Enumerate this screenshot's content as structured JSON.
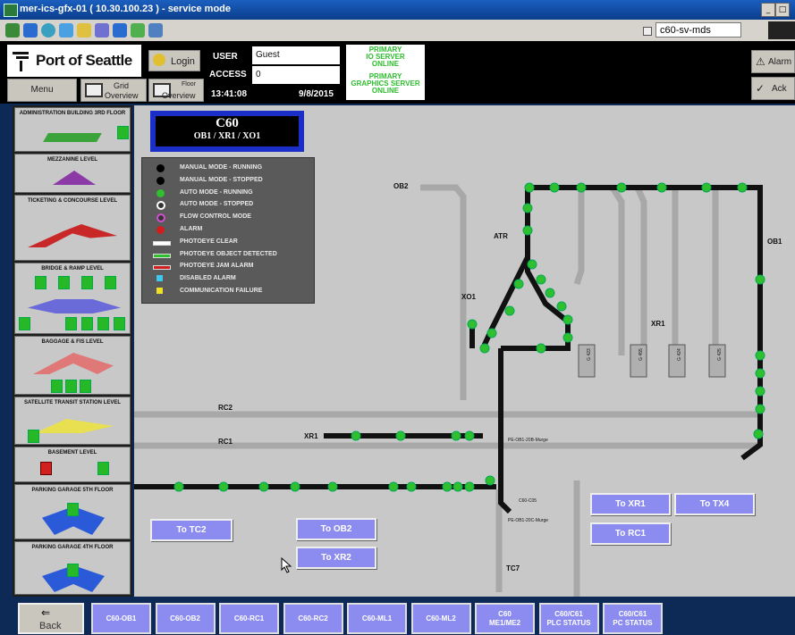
{
  "window": {
    "title": "mer-ics-gfx-01 ( 10.30.100.23 ) - service mode",
    "host": "c60-sv-mds"
  },
  "header": {
    "logo": "Port of Seattle",
    "login": "Login",
    "user_label": "USER",
    "user_value": "Guest",
    "access_label": "ACCESS",
    "access_value": "0",
    "time": "13:41:08",
    "date": "9/8/2015",
    "server1": [
      "PRIMARY",
      "IO SERVER",
      "ONLINE"
    ],
    "server2": [
      "PRIMARY",
      "GRAPHICS SERVER",
      "ONLINE"
    ],
    "menu": "Menu",
    "grid_overview": [
      "Grid",
      "Overview"
    ],
    "floor_overview": [
      "Floor",
      "Overview"
    ],
    "alarm": "Alarm",
    "ack": "Ack"
  },
  "sidebar": [
    "ADMINISTRATION BUILDING 3RD FLOOR",
    "MEZZANINE LEVEL",
    "TICKETING & CONCOURSE LEVEL",
    "BRIDGE & RAMP LEVEL",
    "BAGGAGE & FIS LEVEL",
    "SATELLITE TRANSIT STATION LEVEL",
    "BASEMENT LEVEL",
    "PARKING GARAGE 5TH FLOOR",
    "PARKING GARAGE 4TH FLOOR"
  ],
  "station": {
    "title": "C60",
    "subtitle": "OB1 / XR1 / XO1"
  },
  "legend": [
    {
      "text": "MANUAL MODE - RUNNING",
      "color": "#000000",
      "kind": "dot"
    },
    {
      "text": "MANUAL MODE - STOPPED",
      "color": "#000000",
      "kind": "dot"
    },
    {
      "text": "AUTO MODE - RUNNING",
      "color": "#2fbf2f",
      "kind": "dot"
    },
    {
      "text": "AUTO MODE - STOPPED",
      "color": "#ffffff",
      "kind": "ring"
    },
    {
      "text": "FLOW CONTROL MODE",
      "color": "#d24fd2",
      "kind": "ring"
    },
    {
      "text": "ALARM",
      "color": "#d01e1e",
      "kind": "dot"
    },
    {
      "text": "PHOTOEYE CLEAR",
      "color": "#ffffff",
      "kind": "eye"
    },
    {
      "text": "PHOTOEYE OBJECT DETECTED",
      "color": "#2fbf2f",
      "kind": "eye"
    },
    {
      "text": "PHOTOEYE JAM ALARM",
      "color": "#d01e1e",
      "kind": "eye"
    },
    {
      "text": "DISABLED ALARM",
      "color": "#3cc8f0",
      "kind": "sq"
    },
    {
      "text": "COMMUNICATION FAILURE",
      "color": "#f0e028",
      "kind": "sq"
    }
  ],
  "labels": {
    "ob2": "OB2",
    "ob1": "OB1",
    "atr": "ATR",
    "xo1": "XO1",
    "xr1_top": "XR1",
    "rc2": "RC2",
    "rc1": "RC1",
    "xr1_left": "XR1",
    "tc7": "TC7",
    "pe1": "PE-OB1-20B-Murge",
    "pe2": "PE-OB1-20C-Murge",
    "c60c05": "C60-C05",
    "g1": "G 423",
    "g2": "G 455",
    "g3": "G 424",
    "g4": "G 425"
  },
  "to_buttons": [
    "To TC2",
    "To OB2",
    "To XR2",
    "To XR1",
    "To TX4",
    "To RC1"
  ],
  "nav": {
    "back": "Back",
    "buttons": [
      [
        "C60-OB1"
      ],
      [
        "C60-OB2"
      ],
      [
        "C60-RC1"
      ],
      [
        "C60-RC2"
      ],
      [
        "C60-ML1"
      ],
      [
        "C60-ML2"
      ],
      [
        "C60",
        "ME1/ME2"
      ],
      [
        "C60/C61",
        "PLC STATUS"
      ],
      [
        "C60/C61",
        "PC STATUS"
      ]
    ]
  },
  "colors": {
    "accent": "#8c8cf0",
    "running": "#2fbf2f",
    "background": "#c8c8c8",
    "frame": "#0c2a55"
  }
}
